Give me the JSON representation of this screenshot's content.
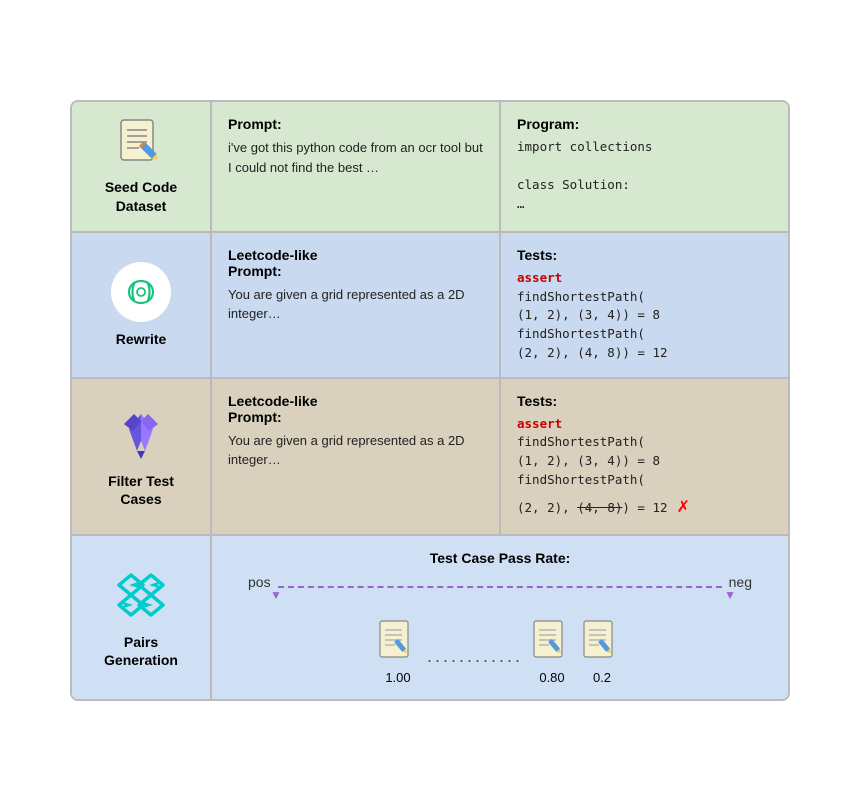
{
  "rows": [
    {
      "id": "seed",
      "bgClass": "row-green",
      "leftLabel": "Seed Code\nDataset",
      "midHeader": "Prompt:",
      "midText": "i've got this python code from an ocr tool but I could not find the best …",
      "rightHeader": "Program:",
      "rightText": "import collections\n\nclass Solution:\n    …",
      "rightRed": false
    },
    {
      "id": "rewrite",
      "bgClass": "row-blue",
      "leftLabel": "Rewrite",
      "midHeader": "Leetcode-like\nPrompt:",
      "midText": "You are given a grid represented as a 2D integer…",
      "rightHeader": "Tests:",
      "rightAssert": "assert",
      "rightCode": "findShortestPath(\n(1, 2), (3, 4)) = 8\nfindShortestPath(\n(2, 2), (4, 8)) = 12",
      "rightRed": true
    },
    {
      "id": "filter",
      "bgClass": "row-tan",
      "leftLabel": "Filter Test\nCases",
      "midHeader": "Leetcode-like\nPrompt:",
      "midText": "You are given a grid represented as a 2D integer…",
      "rightHeader": "Tests:",
      "rightAssert": "assert",
      "rightCode": "findShortestPath(\n(1, 2), (3, 4)) = 8\nfindShortestPath(\n(2, 2), ",
      "rightCodeStrike": "(4, 8)",
      "rightCodeAfter": ") = 12",
      "rightRed": true,
      "hasStrike": true
    },
    {
      "id": "pairs",
      "bgClass": "row-lightblue",
      "leftLabel": "Pairs\nGeneration",
      "header": "Test Case Pass Rate:",
      "posLabel": "pos",
      "negLabel": "neg",
      "docs": [
        {
          "val": "1.00"
        },
        {
          "val": "0.80"
        },
        {
          "val": "0.2"
        }
      ]
    }
  ]
}
